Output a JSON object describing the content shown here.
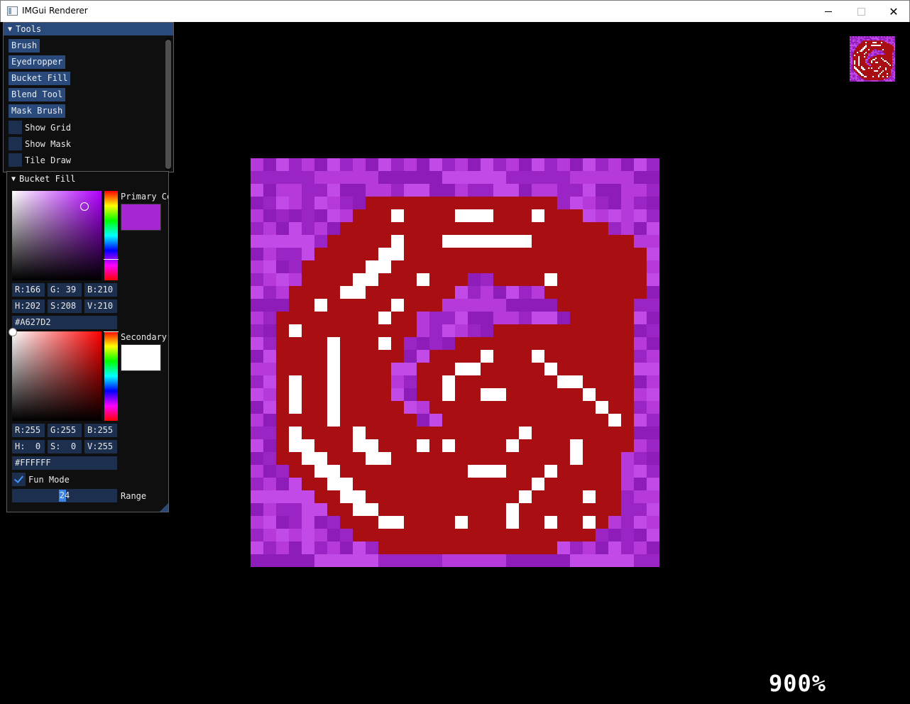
{
  "window": {
    "title": "IMGui Renderer",
    "close_glyph": "✕"
  },
  "tools_panel": {
    "title": "Tools",
    "buttons": [
      "Brush",
      "Eyedropper",
      "Bucket Fill",
      "Blend Tool",
      "Mask Brush"
    ],
    "checkboxes": [
      {
        "label": "Show Grid",
        "checked": false
      },
      {
        "label": "Show Mask",
        "checked": false
      },
      {
        "label": "Tile Draw",
        "checked": false
      }
    ]
  },
  "bucket_panel": {
    "title": "Bucket Fill",
    "primary": {
      "label": "Primary Co",
      "r": "R:166",
      "g": "G: 39",
      "b": "B:210",
      "h": "H:202",
      "s": "S:208",
      "v": "V:210",
      "hex": "#A627D2",
      "color": "#a627d2"
    },
    "secondary": {
      "label": "Secondary",
      "r": "R:255",
      "g": "G:255",
      "b": "B:255",
      "h": "H:  0",
      "s": "S:  0",
      "v": "V:255",
      "hex": "#FFFFFF",
      "color": "#ffffff"
    },
    "fun_mode": {
      "label": "Fun Mode",
      "checked": true
    },
    "range": {
      "label": "Range",
      "value": "24"
    }
  },
  "zoom_label": "900%",
  "image": {
    "palette": {
      "red": "#a80e12",
      "white": "#ffffff",
      "purple_a": "#b53ad9",
      "purple_b": "#9b24c4",
      "purple_c": "#c24ae6",
      "purple_d": "#8e1cb8"
    },
    "pixels": [
      "................................",
      "................................",
      "................................",
      ".........RRRRRRRRRRRRRRR........",
      "........RRRWRRRRWWWRRRWRRR......",
      ".......RRRRRRRRRRRRRRRRRRRRR....",
      "......RRRRRWRRRWWWWWWWRRRRRRRR..",
      ".....RRRRRWWRRRRRRRRRRRRRRRRRRR.",
      "....RRRRRWWRRRRRRRRRRRRRRRRRRRR.",
      "....RRRRWWRRRWRRR..RRRRWRRRRRRR.",
      "...RRRRWWRRRRRRR.......RRRRRRRR.",
      "...RRWRRRRRWRRR.........RRRRRR..",
      "..RRRRRRRRWRR............RRRRR..",
      "..RWRRRRRRRRR......RRRRRRRRRRR..",
      "..RRRRWRRRWR....RRRRRRRRRRRRRR..",
      "..RRRRWRRRRR..RRRRWRRRWRRRRRRR..",
      "..RRRRWRRRR..RRRWWRRRRRWRRRRRR..",
      "..RWRRWRRRR..RRWRRRRRRRRWWRRRR..",
      "..RWRRWRRRR..RRWRRWWRRRRRRWRRR..",
      "..RWRRWRRRRR..RRRRRRRRRRRRRWRR..",
      "..RRRRWRRRRRR..RRRRRRRRRRRRRWR..",
      "..RWRRRRWRRRRRRRRRRRRWRRRRRRRR..",
      "..RWWRRRWWRRRWRWRRRRWRRRRWRRRR..",
      "..RRWWRRRWWRRRRRRRRRRRRRRWRRR...",
      "...RRWWRRRRRRRRRRWWWRRRWRRRRR...",
      "....RRWWRRRRRRRRRRRRRRWRRRRRR...",
      ".....RRWWRRRRRRRRRRRRWRRRRWRR...",
      "......RRWWRRRRRRRRRRWRRRRRRRR...",
      ".......RRRWWRRRRWRRRWRRWRRWR....",
      "........RRRRRRRRRRRRRRRRRRR.....",
      "..........RRRRRRRRRRRRRR........",
      "................................"
    ]
  }
}
